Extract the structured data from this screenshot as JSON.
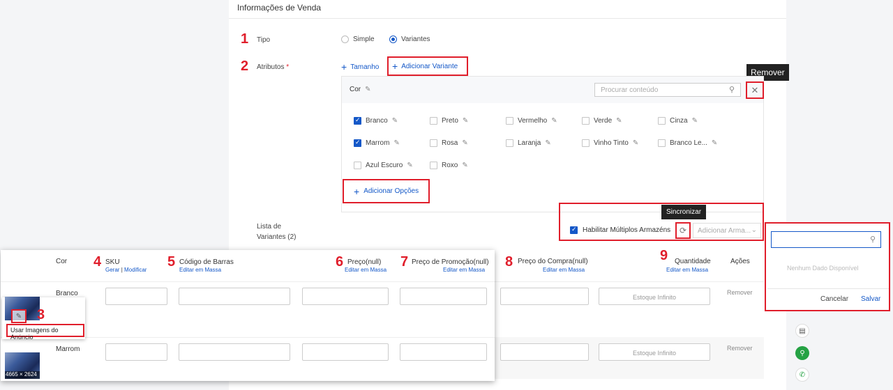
{
  "section": {
    "title": "Informações de Venda"
  },
  "markers": {
    "m1": "1",
    "m2": "2",
    "m3": "3",
    "m4": "4",
    "m5": "5",
    "m6": "6",
    "m7": "7",
    "m8": "8",
    "m9": "9"
  },
  "tipo": {
    "label": "Tipo",
    "opt_simple": "Simple",
    "opt_variantes": "Variantes",
    "selected": "Variantes"
  },
  "atributos": {
    "label": "Atributos",
    "required_mark": "*",
    "tamanho": "Tamanho",
    "add_variant": "Adicionar Variante"
  },
  "attr_card": {
    "name": "Cor",
    "search_placeholder": "Procurar conteúdo",
    "options": [
      {
        "label": "Branco",
        "checked": true
      },
      {
        "label": "Preto",
        "checked": false
      },
      {
        "label": "Vermelho",
        "checked": false
      },
      {
        "label": "Verde",
        "checked": false
      },
      {
        "label": "Cinza",
        "checked": false
      },
      {
        "label": "Marrom",
        "checked": true
      },
      {
        "label": "Rosa",
        "checked": false
      },
      {
        "label": "Laranja",
        "checked": false
      },
      {
        "label": "Vinho Tinto",
        "checked": false
      },
      {
        "label": "Branco Le...",
        "checked": false
      },
      {
        "label": "Azul Escuro",
        "checked": false
      },
      {
        "label": "Roxo",
        "checked": false
      }
    ],
    "add_options": "Adicionar Opções"
  },
  "tooltips": {
    "remover": "Remover",
    "sincronizar": "Sincronizar"
  },
  "variants_list": {
    "label_line1": "Lista de",
    "label_line2": "Variantes (2)",
    "enable_warehouses": "Habilitar Múltiplos Armazéns",
    "add_warehouse_placeholder": "Adicionar Arma..."
  },
  "warehouse_popup": {
    "empty": "Nenhum Dado Disponível",
    "cancel": "Cancelar",
    "save": "Salvar"
  },
  "table": {
    "col_cor": "Cor",
    "col_sku": "SKU",
    "sku_gerar": "Gerar",
    "sku_sep": "|",
    "sku_modificar": "Modificar",
    "col_barcode": "Código de Barras",
    "col_price": "Preço(null)",
    "col_promo": "Preço de Promoção(null)",
    "col_purchase": "Preço do Compra(null)",
    "col_qty": "Quantidade",
    "col_actions": "Ações",
    "bulk_edit": "Editar em Massa",
    "stock_infinite": "Estoque Infinito",
    "remove": "Remover",
    "rows": [
      {
        "color": "Branco"
      },
      {
        "color": "Marrom"
      }
    ],
    "use_ad_images": "Usar Imagens do Anúncio",
    "thumb_size": "4665 × 2624"
  },
  "colors": {
    "accent": "#1458c8",
    "annotation_red": "#e01e2b",
    "whatsapp": "#25a244"
  },
  "side_icons": [
    "document-icon",
    "search-icon",
    "whatsapp-icon"
  ]
}
